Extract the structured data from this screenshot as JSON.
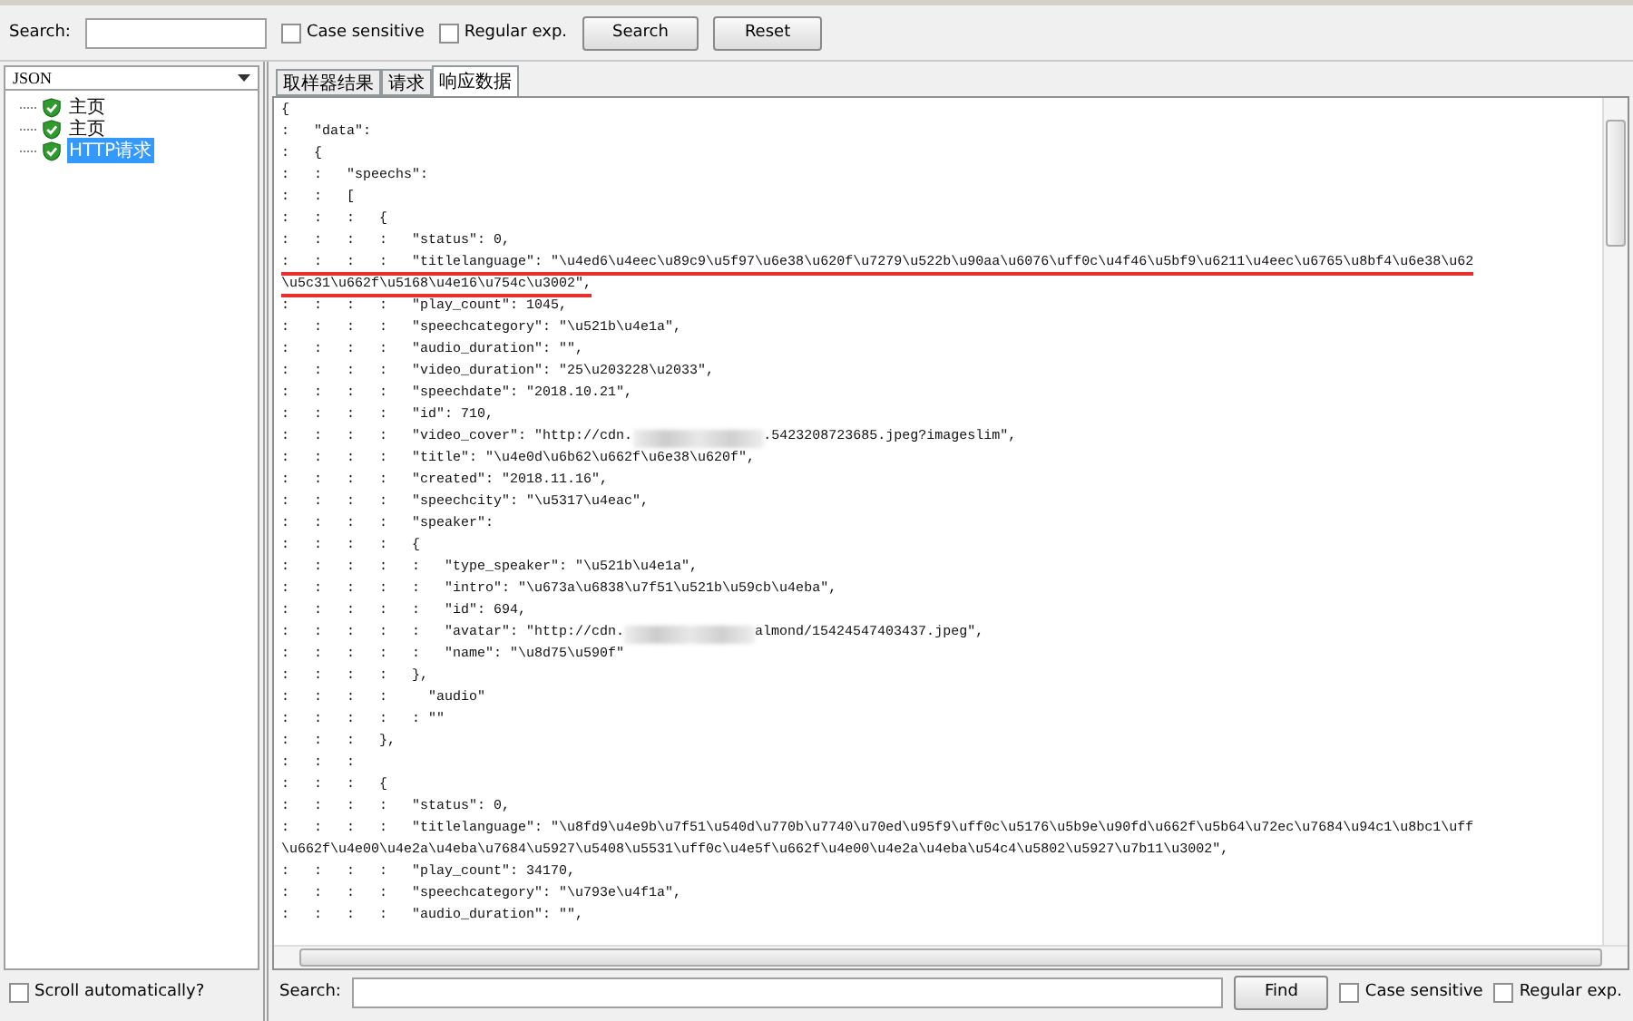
{
  "search_bar": {
    "label": "Search:",
    "options": [
      {
        "label": "Case sensitive",
        "checked": false
      },
      {
        "label": "Regular exp.",
        "checked": false
      }
    ],
    "buttons": [
      "Search",
      "Reset"
    ]
  },
  "left_panel": {
    "renderer": "JSON",
    "tree": [
      {
        "label": "主页",
        "selected": false
      },
      {
        "label": "主页",
        "selected": false
      },
      {
        "label": "HTTP请求",
        "selected": true
      }
    ],
    "scroll_option": {
      "label": "Scroll automatically?",
      "checked": false
    }
  },
  "tabs": [
    {
      "label": "取样器结果",
      "selected": false
    },
    {
      "label": "请求",
      "selected": false
    },
    {
      "label": "响应数据",
      "selected": true
    }
  ],
  "response": {
    "lines": [
      {
        "text": "{",
        "underlined": false
      },
      {
        "text": ":   \"data\":",
        "underlined": false
      },
      {
        "text": ":   {",
        "underlined": false
      },
      {
        "text": ":   :   \"speechs\":",
        "underlined": false
      },
      {
        "text": ":   :   [",
        "underlined": false
      },
      {
        "text": ":   :   :   {",
        "underlined": false
      },
      {
        "text": ":   :   :   :   \"status\": 0,",
        "underlined": false
      },
      {
        "text": ":   :   :   :   \"titlelanguage\": \"\\u4ed6\\u4eec\\u89c9\\u5f97\\u6e38\\u620f\\u7279\\u522b\\u90aa\\u6076\\uff0c\\u4f46\\u5bf9\\u6211\\u4eec\\u6765\\u8bf4\\u6e38\\u62",
        "underlined": true
      },
      {
        "text": "\\u5c31\\u662f\\u5168\\u4e16\\u754c\\u3002\",",
        "underlined": true
      },
      {
        "text": ":   :   :   :   \"play_count\": 1045,",
        "underlined": false
      },
      {
        "text": ":   :   :   :   \"speechcategory\": \"\\u521b\\u4e1a\",",
        "underlined": false
      },
      {
        "text": ":   :   :   :   \"audio_duration\": \"\",",
        "underlined": false
      },
      {
        "text": ":   :   :   :   \"video_duration\": \"25\\u203228\\u2033\",",
        "underlined": false
      },
      {
        "text": ":   :   :   :   \"speechdate\": \"2018.10.21\",",
        "underlined": false
      },
      {
        "text": ":   :   :   :   \"id\": 710,",
        "underlined": false
      },
      {
        "text": ":   :   :   :   \"video_cover\": \"http://cdn.",
        "text_after_blur": ".5423208723685.jpeg?imageslim\",",
        "underlined": false
      },
      {
        "text": ":   :   :   :   \"title\": \"\\u4e0d\\u6b62\\u662f\\u6e38\\u620f\",",
        "underlined": false
      },
      {
        "text": ":   :   :   :   \"created\": \"2018.11.16\",",
        "underlined": false
      },
      {
        "text": ":   :   :   :   \"speechcity\": \"\\u5317\\u4eac\",",
        "underlined": false
      },
      {
        "text": ":   :   :   :   \"speaker\":",
        "underlined": false
      },
      {
        "text": ":   :   :   :   {",
        "underlined": false
      },
      {
        "text": ":   :   :   :   :   \"type_speaker\": \"\\u521b\\u4e1a\",",
        "underlined": false
      },
      {
        "text": ":   :   :   :   :   \"intro\": \"\\u673a\\u6838\\u7f51\\u521b\\u59cb\\u4eba\",",
        "underlined": false
      },
      {
        "text": ":   :   :   :   :   \"id\": 694,",
        "underlined": false
      },
      {
        "text": ":   :   :   :   :   \"avatar\": \"http://cdn.",
        "text_after_blur": "almond/15424547403437.jpeg\",",
        "underlined": false
      },
      {
        "text": ":   :   :   :   :   \"name\": \"\\u8d75\\u590f\"",
        "underlined": false
      },
      {
        "text": ":   :   :   :   },",
        "underlined": false
      },
      {
        "text": ":   :   :   :     \"audio\"",
        "underlined": false
      },
      {
        "text": ":   :   :   :   : \"\"",
        "underlined": false
      },
      {
        "text": ":   :   :   },",
        "underlined": false
      },
      {
        "text": ":   :   :",
        "underlined": false
      },
      {
        "text": ":   :   :   {",
        "underlined": false
      },
      {
        "text": ":   :   :   :   \"status\": 0,",
        "underlined": false
      },
      {
        "text": ":   :   :   :   \"titlelanguage\": \"\\u8fd9\\u4e9b\\u7f51\\u540d\\u770b\\u7740\\u70ed\\u95f9\\uff0c\\u5176\\u5b9e\\u90fd\\u662f\\u5b64\\u72ec\\u7684\\u94c1\\u8bc1\\uff",
        "underlined": false
      },
      {
        "text": "\\u662f\\u4e00\\u4e2a\\u4eba\\u7684\\u5927\\u5408\\u5531\\uff0c\\u4e5f\\u662f\\u4e00\\u4e2a\\u4eba\\u54c4\\u5802\\u5927\\u7b11\\u3002\",",
        "underlined": false
      },
      {
        "text": ":   :   :   :   \"play_count\": 34170,",
        "underlined": false
      },
      {
        "text": ":   :   :   :   \"speechcategory\": \"\\u793e\\u4f1a\",",
        "underlined": false
      },
      {
        "text": ":   :   :   :   \"audio_duration\": \"\",",
        "underlined": false
      }
    ]
  },
  "find_bar": {
    "label": "Search:",
    "button": "Find",
    "options": [
      {
        "label": "Case sensitive",
        "checked": false
      },
      {
        "label": "Regular exp.",
        "checked": false
      }
    ]
  }
}
